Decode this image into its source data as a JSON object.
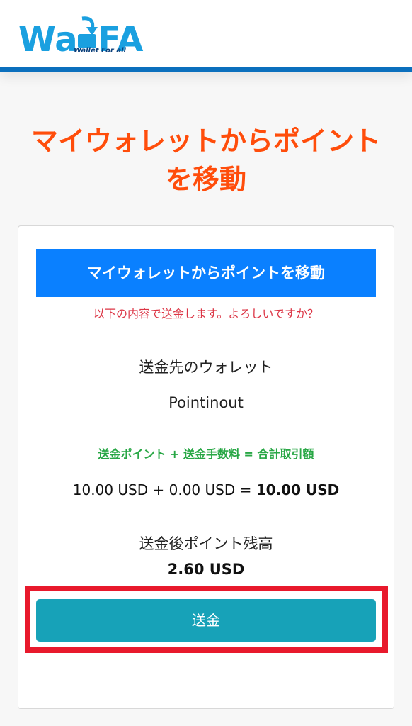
{
  "header": {
    "logo_main_left": "Wa",
    "logo_main_right": "FA",
    "logo_tagline": "Wallet For all",
    "logo_color": "#1aa0e0"
  },
  "page": {
    "title_line1": "マイウォレットからポイント",
    "title_line2": "を移動",
    "title_color": "#ff4d0b"
  },
  "card": {
    "header_label": "マイウォレットからポイントを移動",
    "confirm_message": "以下の内容で送金します。よろしいですか？",
    "destination_label": "送金先のウォレット",
    "destination_value": "Pointinout",
    "formula_label": "送金ポイント + 送金手数料 = 合計取引額",
    "amount_send": "10.00 USD",
    "plus": " + ",
    "amount_fee": "0.00 USD",
    "equals": " = ",
    "amount_total": "10.00 USD",
    "balance_label": "送金後ポイント残高",
    "balance_value": "2.60 USD",
    "send_button_label": "送金"
  },
  "colors": {
    "header_bar": "#0b6fbd",
    "card_header_bg": "#0a80ff",
    "confirm_text": "#dc3545",
    "formula_label": "#28a745",
    "send_button_bg": "#17a2b8",
    "highlight_frame": "#e8192c"
  }
}
